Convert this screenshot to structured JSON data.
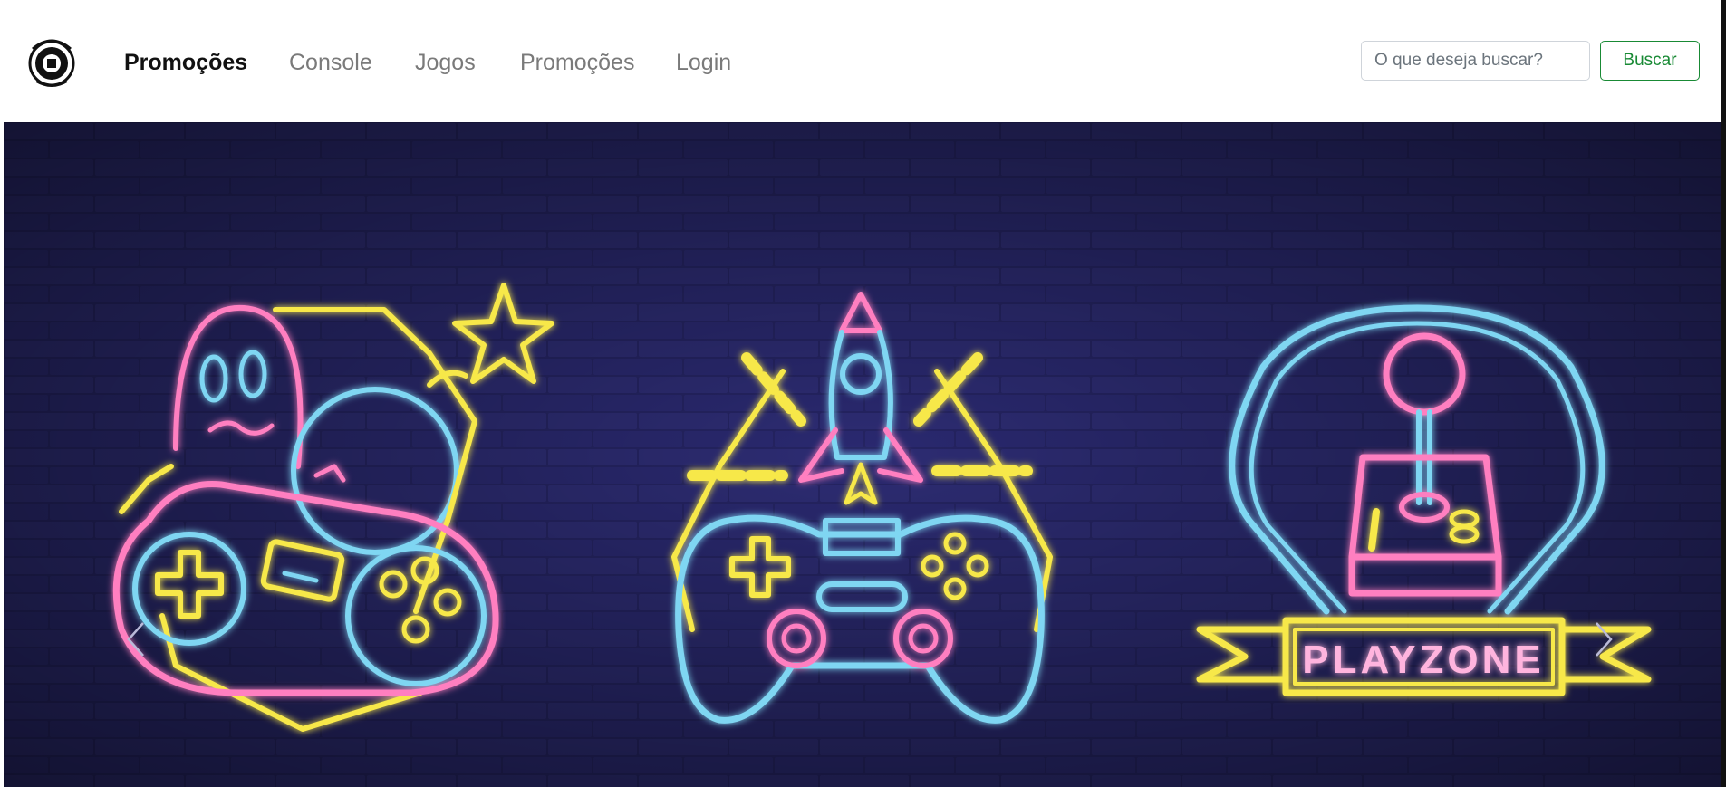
{
  "navbar": {
    "logo_icon": "gaming-store-logo",
    "brand": "Promoções",
    "links": [
      "Console",
      "Jogos",
      "Promoções",
      "Login"
    ],
    "search": {
      "placeholder": "O que deseja buscar?",
      "value": "",
      "button_label": "Buscar"
    }
  },
  "carousel": {
    "slide_text": "PLAYZONE",
    "prev_icon": "chevron-left-icon",
    "next_icon": "chevron-right-icon"
  },
  "colors": {
    "brand_green": "#198a35",
    "wall_dark": "#1e1d4a",
    "neon_pink": "#ff7fc0",
    "neon_blue": "#7fd6f2",
    "neon_yellow": "#f7e84a"
  }
}
